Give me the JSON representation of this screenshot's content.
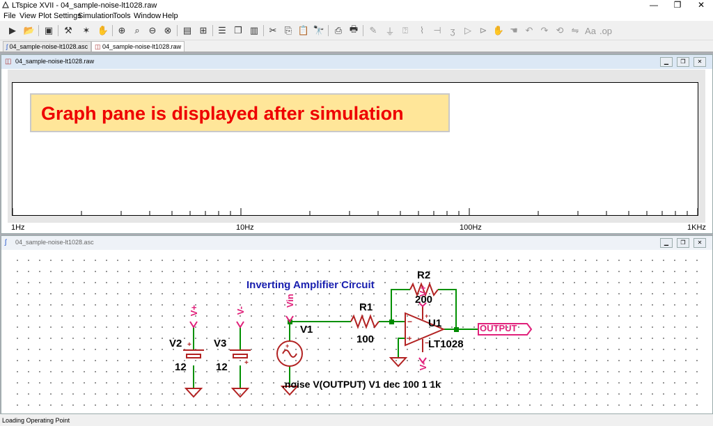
{
  "window": {
    "title": "LTspice XVII - 04_sample-noise-lt1028.raw",
    "minimize": "—",
    "restore": "❐",
    "close": "✕"
  },
  "menu": [
    "File",
    "View",
    "Plot Settings",
    "Simulation",
    "Tools",
    "Window",
    "Help"
  ],
  "toolbar": {
    "icons": [
      "run-icon",
      "open-icon",
      "save-icon",
      "control-panel-icon",
      "halt-icon",
      "pan-icon",
      "zoom-in-icon",
      "zoom-box-icon",
      "zoom-out-icon",
      "zoom-cancel-icon",
      "autorange-icon",
      "grid-icon",
      "tile-horizontal-icon",
      "cascade-icon",
      "tile-vertical-icon",
      "cut-icon",
      "copy-icon",
      "paste-icon",
      "find-icon",
      "print-setup-icon",
      "print-icon",
      "wire-icon",
      "ground-icon",
      "label-icon",
      "resistor-icon",
      "capacitor-icon",
      "inductor-icon",
      "diode-icon",
      "component-icon",
      "move-icon",
      "drag-icon",
      "undo-icon",
      "redo-icon",
      "rotate-icon",
      "mirror-icon",
      "text-icon",
      "spice-directive-icon"
    ]
  },
  "tabs": [
    {
      "label": "04_sample-noise-lt1028.asc"
    },
    {
      "label": "04_sample-noise-lt1028.raw"
    }
  ],
  "plot_window": {
    "title": "04_sample-noise-lt1028.raw",
    "callout": "Graph pane is displayed after simulation",
    "x_ticks": [
      "1Hz",
      "10Hz",
      "100Hz",
      "1KHz"
    ]
  },
  "schematic_window": {
    "title": "04_sample-noise-lt1028.asc",
    "heading": "Inverting Amplifier Circuit",
    "components": {
      "r1_name": "R1",
      "r1_value": "100",
      "r2_name": "R2",
      "r2_value": "200",
      "v1_name": "V1",
      "v2_name": "V2",
      "v2_value": "12",
      "v3_name": "V3",
      "v3_value": "12",
      "u1_name": "U1",
      "u1_model": "LT1028"
    },
    "nets": {
      "vin": "Vin",
      "vplus": "V+",
      "vminus": "V-",
      "output": "OUTPUT"
    },
    "directive": ".noise V(OUTPUT) V1 dec 100 1 1k"
  },
  "status": "Loading Operating Point",
  "colors": {
    "net_label": "#e0207a",
    "component": "#b22222",
    "wire": "#009000",
    "heading": "#1a20b0",
    "callout_text": "#ee0000",
    "callout_bg": "#ffe699"
  }
}
